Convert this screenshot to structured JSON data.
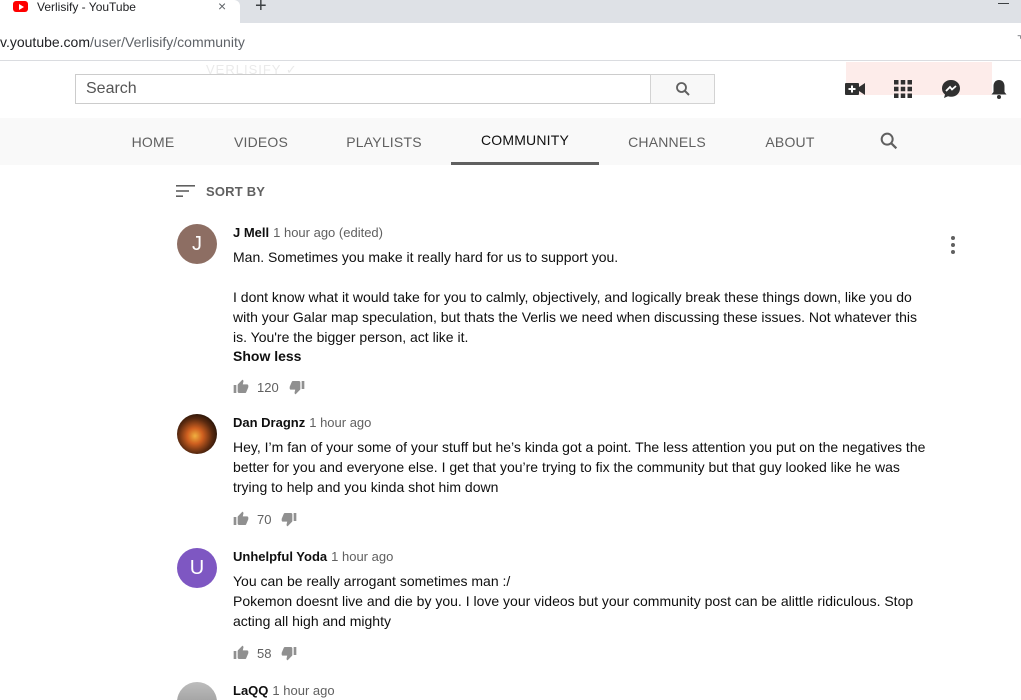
{
  "browser": {
    "tab_title": "Verlisify - YouTube",
    "tab_close": "×",
    "new_tab": "+",
    "url_host": "v.youtube.com",
    "url_path": "/user/Verlisify/community"
  },
  "header": {
    "search_placeholder": "Search",
    "faded_channel": "VERLISIFY ✓"
  },
  "channel_tabs": [
    {
      "label": "HOME"
    },
    {
      "label": "VIDEOS"
    },
    {
      "label": "PLAYLISTS"
    },
    {
      "label": "COMMUNITY",
      "active": true
    },
    {
      "label": "CHANNELS"
    },
    {
      "label": "ABOUT"
    }
  ],
  "sort": {
    "label": "SORT BY"
  },
  "comments": [
    {
      "author": "J Mell",
      "time": "1 hour ago (edited)",
      "avatar_letter": "J",
      "avatar_color": "#8d6e63",
      "text": "Man. Sometimes you make it really hard for us to support you.\n\nI dont know what it would take for you to calmly, objectively, and logically break these things down, like you do with your Galar map speculation, but thats the Verlis we need when discussing these issues. Not whatever this is. You're the bigger person, act like it.",
      "show_less": "Show less",
      "likes": "120"
    },
    {
      "author": "Dan Dragnz",
      "time": "1 hour ago",
      "avatar_letter": "",
      "avatar_color": "#3a2a1a",
      "text": "Hey, I’m fan of your some of your stuff but he’s kinda got a point. The less attention you put on the negatives the better for you and everyone else. I get that you’re trying to fix the community but that guy looked like he was trying to help and you kinda shot him down",
      "likes": "70"
    },
    {
      "author": "Unhelpful Yoda",
      "time": "1 hour ago",
      "avatar_letter": "U",
      "avatar_color": "#7e57c2",
      "text": "You can be really arrogant sometimes man :/\nPokemon doesnt live and die by you. I love your videos but your community post can be alittle ridiculous. Stop acting all high and mighty",
      "likes": "58"
    },
    {
      "author": "LaQQ",
      "time": "1 hour ago",
      "avatar_letter": "",
      "avatar_color": "#9e9e9e"
    }
  ]
}
